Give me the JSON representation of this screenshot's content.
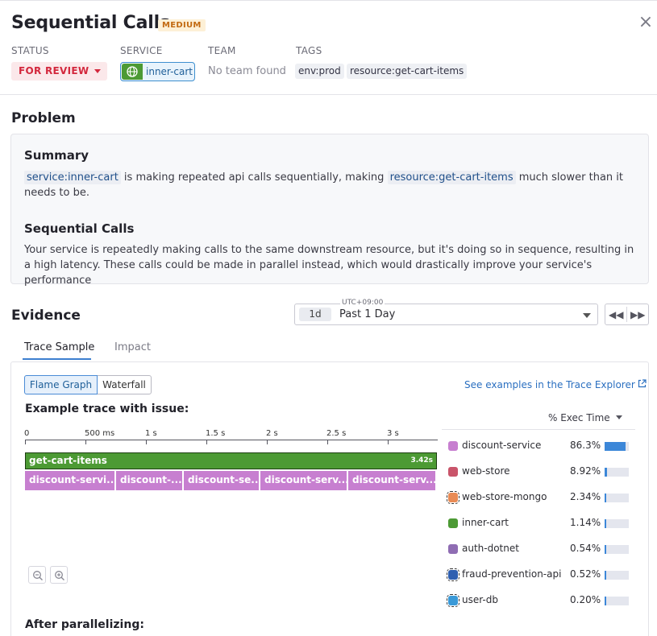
{
  "header": {
    "title": "Sequential Calls",
    "severity": "MEDIUM",
    "close_glyph": "×",
    "labels": {
      "status": "STATUS",
      "service": "SERVICE",
      "team": "TEAM",
      "tags": "TAGS"
    },
    "status_value": "FOR REVIEW",
    "service_value": "inner-cart",
    "team_value": "No team found",
    "tags": [
      "env:prod",
      "resource:get-cart-items"
    ]
  },
  "problem": {
    "heading": "Problem",
    "summary_heading": "Summary",
    "summary_chip1": "service:inner-cart",
    "summary_text1": " is making repeated api calls sequentially, making ",
    "summary_chip2": "resource:get-cart-items",
    "summary_text2": " much slower than it needs to be.",
    "seq_heading": "Sequential Calls",
    "seq_text": "Your service is repeatedly making calls to the same downstream resource, but it's doing so in sequence, resulting in a high latency. These calls could be made in parallel instead, which would drastically improve your service's performance"
  },
  "evidence": {
    "heading": "Evidence",
    "timezone": "UTC+09:00",
    "range_short": "1d",
    "range_label": "Past 1 Day",
    "tabs": [
      "Trace Sample",
      "Impact"
    ],
    "view_modes": [
      "Flame Graph",
      "Waterfall"
    ],
    "explorer_link": "See examples in the Trace Explorer",
    "example_heading": "Example trace with issue:",
    "axis_ticks": [
      {
        "label": "0",
        "t": 0
      },
      {
        "label": "500 ms",
        "t": 0.5
      },
      {
        "label": "1 s",
        "t": 1.0
      },
      {
        "label": "1.5 s",
        "t": 1.5
      },
      {
        "label": "2 s",
        "t": 2.0
      },
      {
        "label": "2.5 s",
        "t": 2.5
      },
      {
        "label": "3 s",
        "t": 3.0
      }
    ],
    "root_span": {
      "name": "get-cart-items",
      "duration": "3.42s"
    },
    "child_spans": [
      {
        "label": "discount-servi..."
      },
      {
        "label": "discount-..."
      },
      {
        "label": "discount-se..."
      },
      {
        "label": "discount-serv..."
      },
      {
        "label": "discount-serv..."
      }
    ],
    "exec_header": "% Exec Time",
    "services": [
      {
        "name": "discount-service",
        "pct": "86.3%",
        "value": 0.863,
        "color": "#c77fd0",
        "dashed": false
      },
      {
        "name": "web-store",
        "pct": "8.92%",
        "value": 0.0892,
        "color": "#c9546a",
        "dashed": false
      },
      {
        "name": "web-store-mongo",
        "pct": "2.34%",
        "value": 0.0234,
        "color": "#e98b55",
        "dashed": true
      },
      {
        "name": "inner-cart",
        "pct": "1.14%",
        "value": 0.0114,
        "color": "#4c9a34",
        "dashed": false
      },
      {
        "name": "auth-dotnet",
        "pct": "0.54%",
        "value": 0.0054,
        "color": "#8f6db3",
        "dashed": false
      },
      {
        "name": "fraud-prevention-api",
        "pct": "0.52%",
        "value": 0.0052,
        "color": "#2f5fb0",
        "dashed": true
      },
      {
        "name": "user-db",
        "pct": "0.20%",
        "value": 0.002,
        "color": "#3a9ad8",
        "dashed": true
      }
    ],
    "after_heading": "After parallelizing:"
  }
}
